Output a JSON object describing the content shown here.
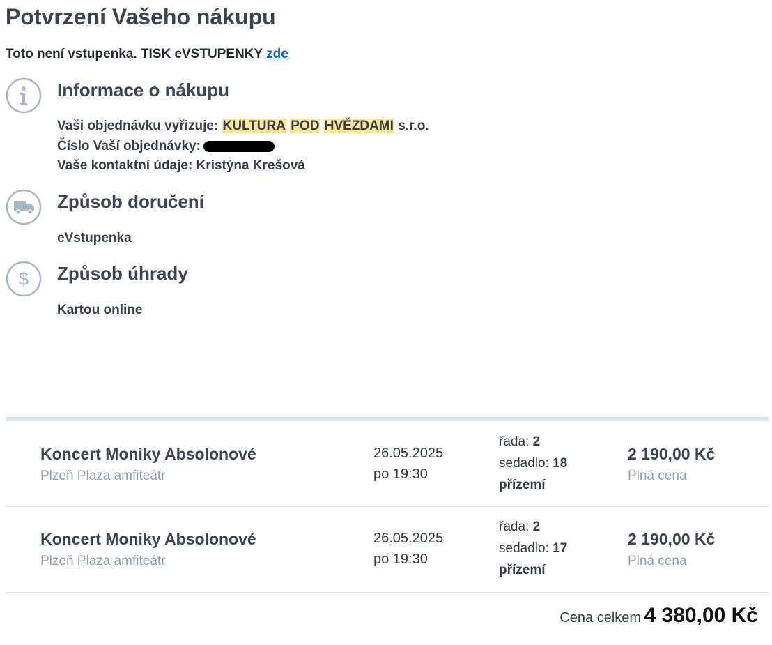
{
  "header": {
    "title": "Potvrzení Vašeho nákupu",
    "notice_text": "Toto není vstupenka. TISK eVSTUPENKY",
    "notice_link": "zde"
  },
  "purchase_info": {
    "icon": "info-icon",
    "title": "Informace o nákupu",
    "handler_label": "Vaši objednávku vyřizuje:",
    "handler_words": [
      "KULTURA",
      "POD",
      "HVĚZDAMI"
    ],
    "handler_suffix": "s.r.o.",
    "order_label": "Číslo Vaší objednávky:",
    "contact_label": "Vaše kontaktní údaje:",
    "contact_value": "Kristýna Krešová"
  },
  "delivery": {
    "icon": "truck-icon",
    "title": "Způsob doručení",
    "value": "eVstupenka"
  },
  "payment": {
    "icon": "dollar-icon",
    "title": "Způsob úhrady",
    "value": "Kartou online"
  },
  "tickets": [
    {
      "event": "Koncert Moniky Absolonové",
      "venue": "Plzeň Plaza amfiteátr",
      "date": "26.05.2025",
      "time": "po 19:30",
      "row_label": "řada:",
      "row": "2",
      "seat_label": "sedadlo:",
      "seat": "18",
      "section": "přízemí",
      "price": "2 190,00 Kč",
      "price_type": "Plná cena"
    },
    {
      "event": "Koncert Moniky Absolonové",
      "venue": "Plzeň Plaza amfiteátr",
      "date": "26.05.2025",
      "time": "po 19:30",
      "row_label": "řada:",
      "row": "2",
      "seat_label": "sedadlo:",
      "seat": "17",
      "section": "přízemí",
      "price": "2 190,00 Kč",
      "price_type": "Plná cena"
    }
  ],
  "total": {
    "label": "Cena celkem",
    "value": "4 380,00 Kč"
  },
  "colors": {
    "highlight": "#ffe49a",
    "link": "#1a5bd1",
    "muted": "#8f9eb0",
    "icon_stroke": "#a9b6c4"
  }
}
